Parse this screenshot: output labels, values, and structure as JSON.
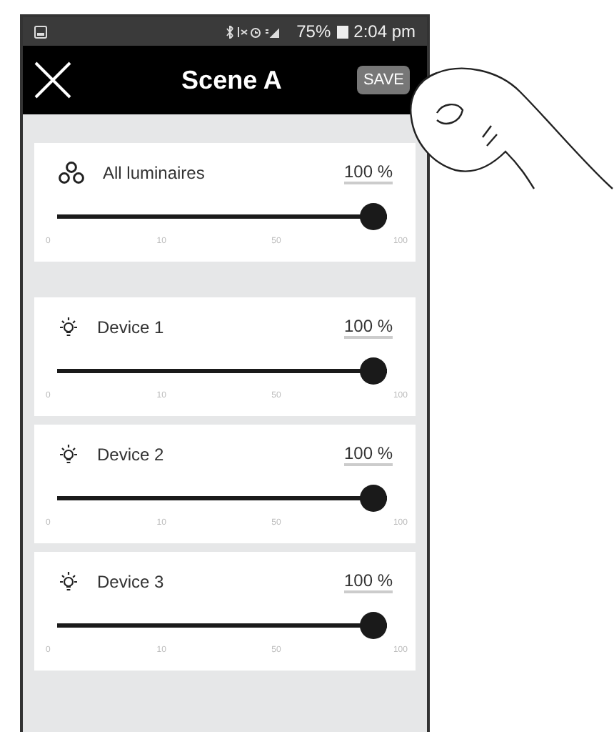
{
  "status_bar": {
    "battery": "75%",
    "time": "2:04 pm"
  },
  "header": {
    "title": "Scene A",
    "save": "SAVE"
  },
  "groups": [
    {
      "kind": "group",
      "name": "All luminaires",
      "value": "100 %",
      "level": 1,
      "ticks": [
        "0",
        "10",
        "50",
        "100"
      ]
    },
    {
      "kind": "device",
      "name": "Device 1",
      "value": "100 %",
      "level": 1,
      "ticks": [
        "0",
        "10",
        "50",
        "100"
      ]
    },
    {
      "kind": "device",
      "name": "Device 2",
      "value": "100 %",
      "level": 1,
      "ticks": [
        "0",
        "10",
        "50",
        "100"
      ]
    },
    {
      "kind": "device",
      "name": "Device 3",
      "value": "100 %",
      "level": 1,
      "ticks": [
        "0",
        "10",
        "50",
        "100"
      ]
    }
  ]
}
